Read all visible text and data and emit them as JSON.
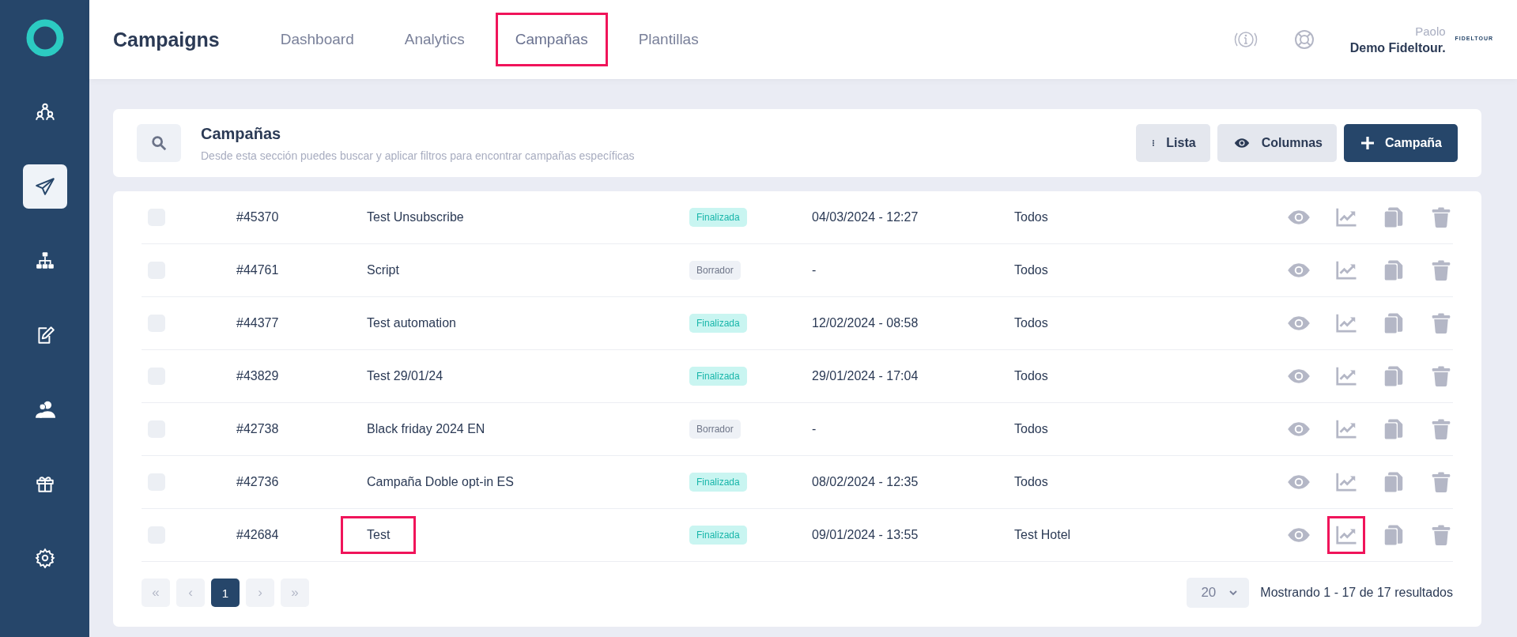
{
  "sidebar": {
    "items": [
      {
        "selected": false
      },
      {
        "selected": true
      },
      {
        "selected": false
      },
      {
        "selected": false
      },
      {
        "selected": false
      },
      {
        "selected": false
      },
      {
        "selected": false
      }
    ]
  },
  "header": {
    "title": "Campaigns",
    "tabs": [
      {
        "label": "Dashboard",
        "selected": false,
        "highlighted": false
      },
      {
        "label": "Analytics",
        "selected": false,
        "highlighted": false
      },
      {
        "label": "Campañas",
        "selected": true,
        "highlighted": true
      },
      {
        "label": "Plantillas",
        "selected": false,
        "highlighted": false
      }
    ],
    "user_name": "Paolo",
    "account": "Demo Fideltour.",
    "logo": "FIDELTOUR"
  },
  "section": {
    "title": "Campañas",
    "description": "Desde esta sección puedes buscar y aplicar filtros para encontrar campañas específicas",
    "buttons": [
      {
        "kind": "list",
        "label": "Lista"
      },
      {
        "kind": "columns",
        "label": "Columnas"
      },
      {
        "kind": "add",
        "label": "Campaña"
      }
    ]
  },
  "table": {
    "rows": [
      {
        "checked": false,
        "id": "#45370",
        "name": "Test Unsubscribe",
        "name_highlighted": false,
        "status": "Finalizada",
        "kind": "finished",
        "date": "04/03/2024 - 12:27",
        "segment": "Todos",
        "stats_highlighted": false
      },
      {
        "checked": false,
        "id": "#44761",
        "name": "Script",
        "name_highlighted": false,
        "status": "Borrador",
        "kind": "draft",
        "date": "-",
        "segment": "Todos",
        "stats_highlighted": false
      },
      {
        "checked": false,
        "id": "#44377",
        "name": "Test automation",
        "name_highlighted": false,
        "status": "Finalizada",
        "kind": "finished",
        "date": "12/02/2024 - 08:58",
        "segment": "Todos",
        "stats_highlighted": false
      },
      {
        "checked": false,
        "id": "#43829",
        "name": "Test 29/01/24",
        "name_highlighted": false,
        "status": "Finalizada",
        "kind": "finished",
        "date": "29/01/2024 - 17:04",
        "segment": "Todos",
        "stats_highlighted": false
      },
      {
        "checked": false,
        "id": "#42738",
        "name": "Black friday 2024 EN",
        "name_highlighted": false,
        "status": "Borrador",
        "kind": "draft",
        "date": "-",
        "segment": "Todos",
        "stats_highlighted": false
      },
      {
        "checked": false,
        "id": "#42736",
        "name": "Campaña Doble opt-in ES",
        "name_highlighted": false,
        "status": "Finalizada",
        "kind": "finished",
        "date": "08/02/2024 - 12:35",
        "segment": "Todos",
        "stats_highlighted": false
      },
      {
        "checked": false,
        "id": "#42684",
        "name": "Test",
        "name_highlighted": true,
        "status": "Finalizada",
        "kind": "finished",
        "date": "09/01/2024 - 13:55",
        "segment": "Test Hotel",
        "stats_highlighted": true
      }
    ]
  },
  "pagination": {
    "buttons": [
      {
        "label": "«",
        "selected": false
      },
      {
        "label": "‹",
        "selected": false
      },
      {
        "label": "1",
        "selected": true
      },
      {
        "label": "›",
        "selected": false
      },
      {
        "label": "»",
        "selected": false
      }
    ],
    "page_size": "20",
    "summary": "Mostrando 1 - 17 de 17 resultados"
  }
}
